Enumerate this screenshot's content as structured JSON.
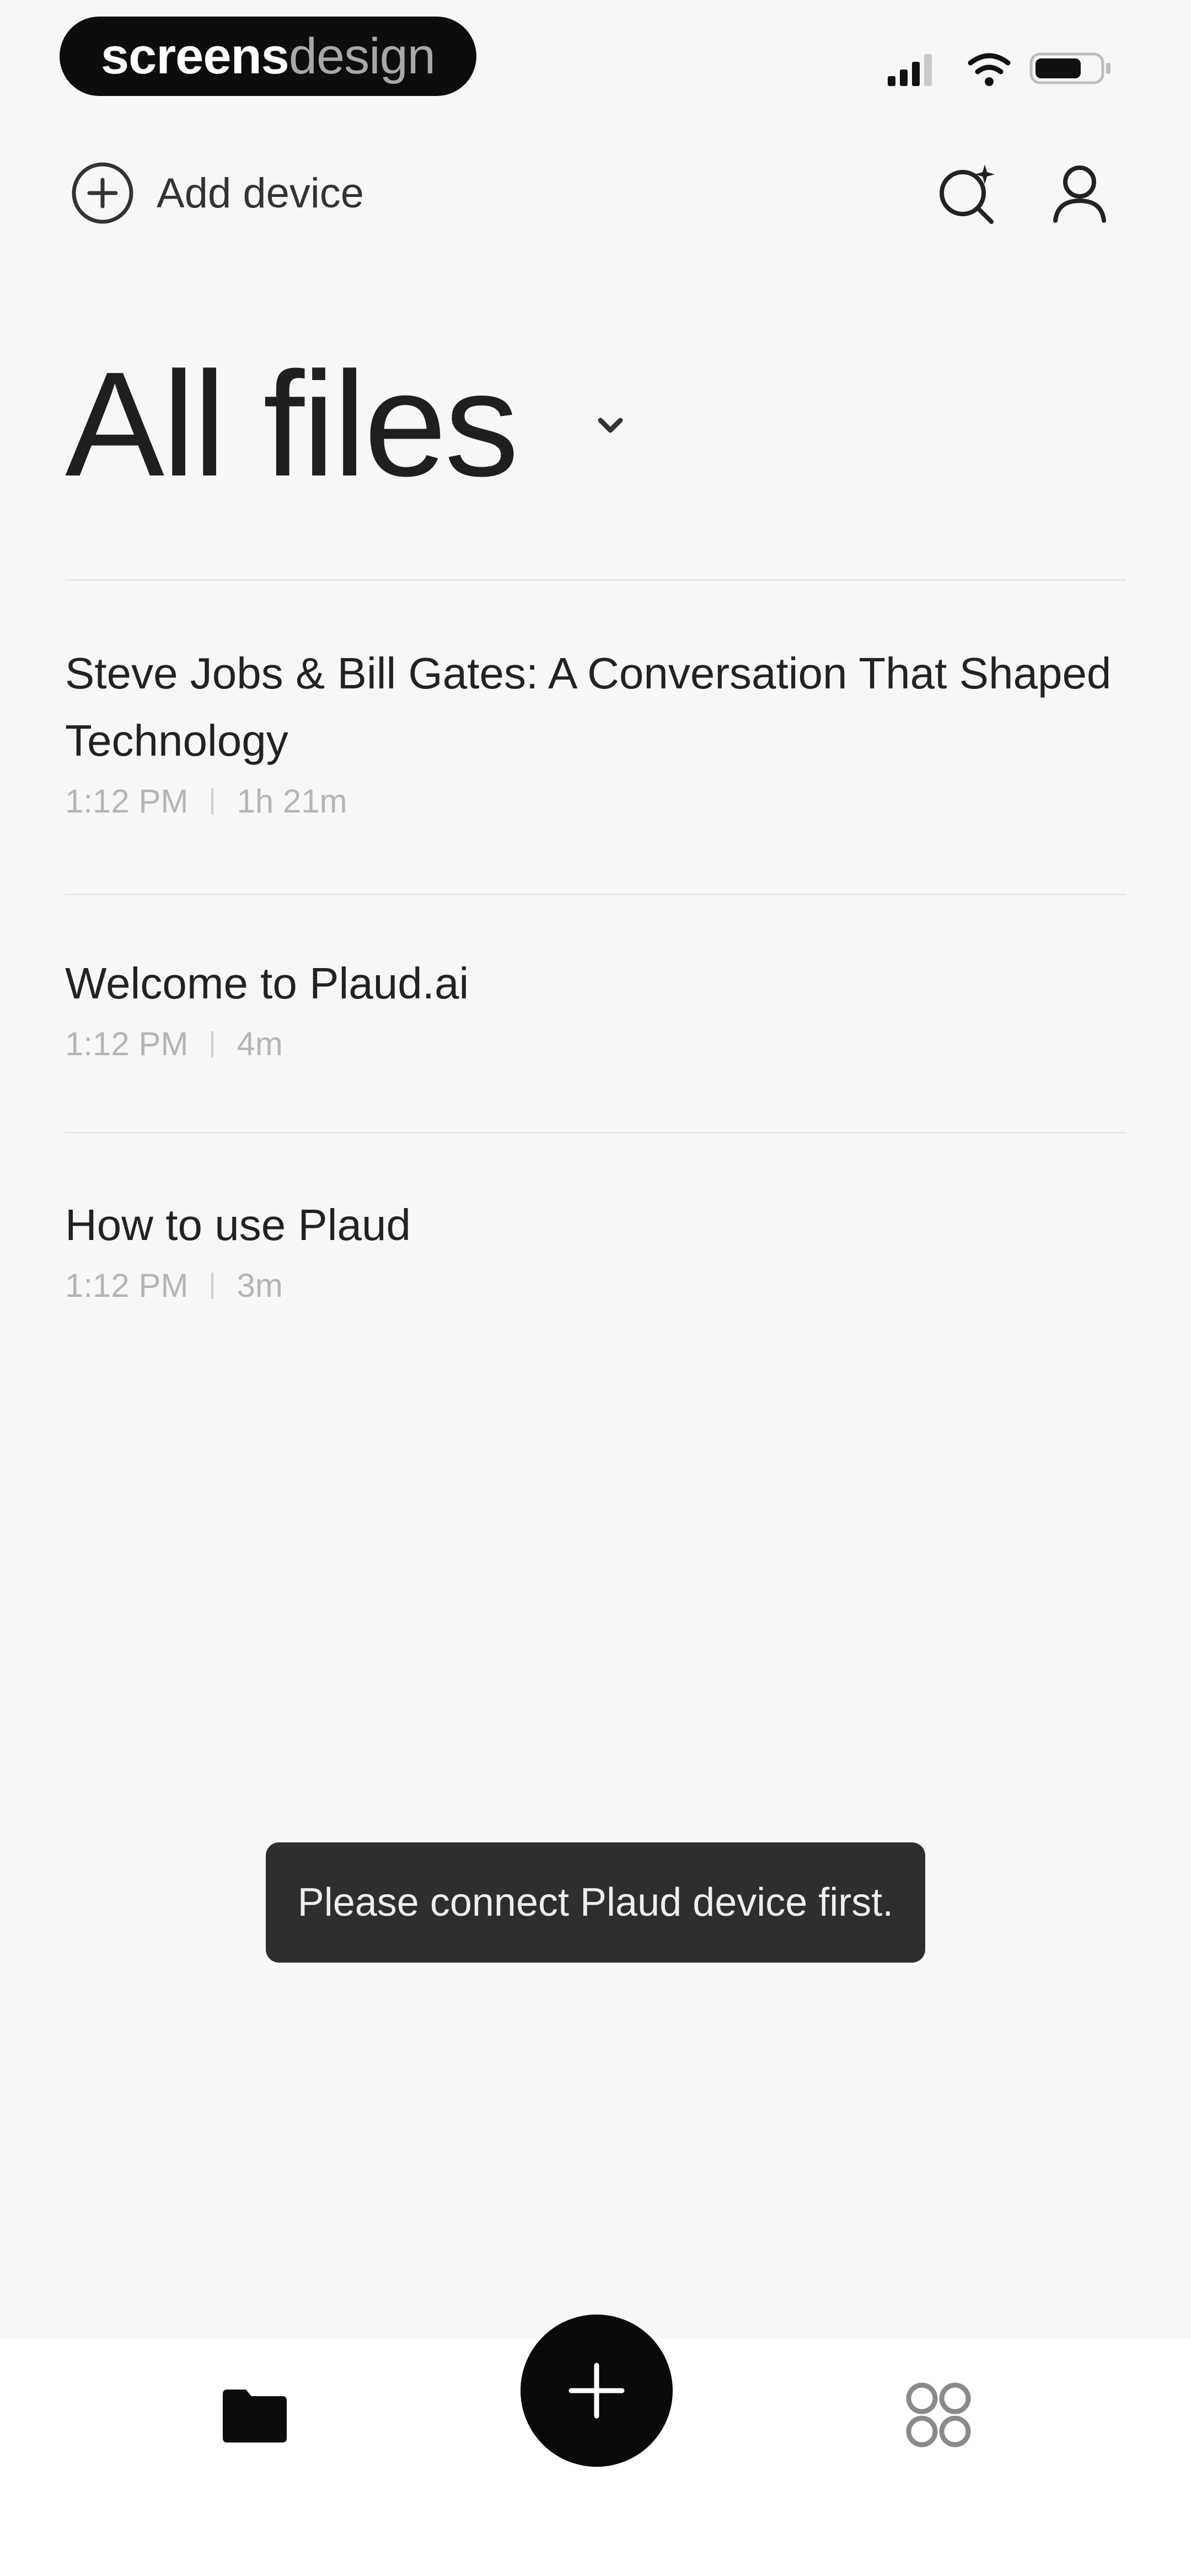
{
  "status_bar": {
    "brand_bold": "screens",
    "brand_light": "design",
    "icons": [
      "cellular-signal-icon",
      "wifi-icon",
      "battery-icon"
    ]
  },
  "top_bar": {
    "add_device_label": "Add device",
    "add_device_icon": "plus-circle-icon",
    "search_icon": "search-sparkle-icon",
    "profile_icon": "user-icon"
  },
  "page": {
    "title": "All files",
    "title_caret_icon": "chevron-down-icon"
  },
  "files": [
    {
      "title": "Steve Jobs & Bill Gates: A Conversation That Shaped Technology",
      "time": "1:12 PM",
      "duration": "1h 21m"
    },
    {
      "title": "Welcome to Plaud.ai",
      "time": "1:12 PM",
      "duration": "4m"
    },
    {
      "title": "How to use Plaud",
      "time": "1:12 PM",
      "duration": "3m"
    }
  ],
  "toast": {
    "message": "Please connect Plaud device first."
  },
  "bottom_nav": {
    "files_icon": "folder-icon",
    "record_icon": "plus-icon",
    "apps_icon": "apps-grid-icon"
  },
  "colors": {
    "background": "#f7f7f7",
    "text_primary": "#1f1f1f",
    "text_secondary": "#b5b5b5",
    "toast_bg": "#2e2e2e",
    "fab_bg": "#0a0a0a",
    "nav_bg": "#ffffff"
  }
}
